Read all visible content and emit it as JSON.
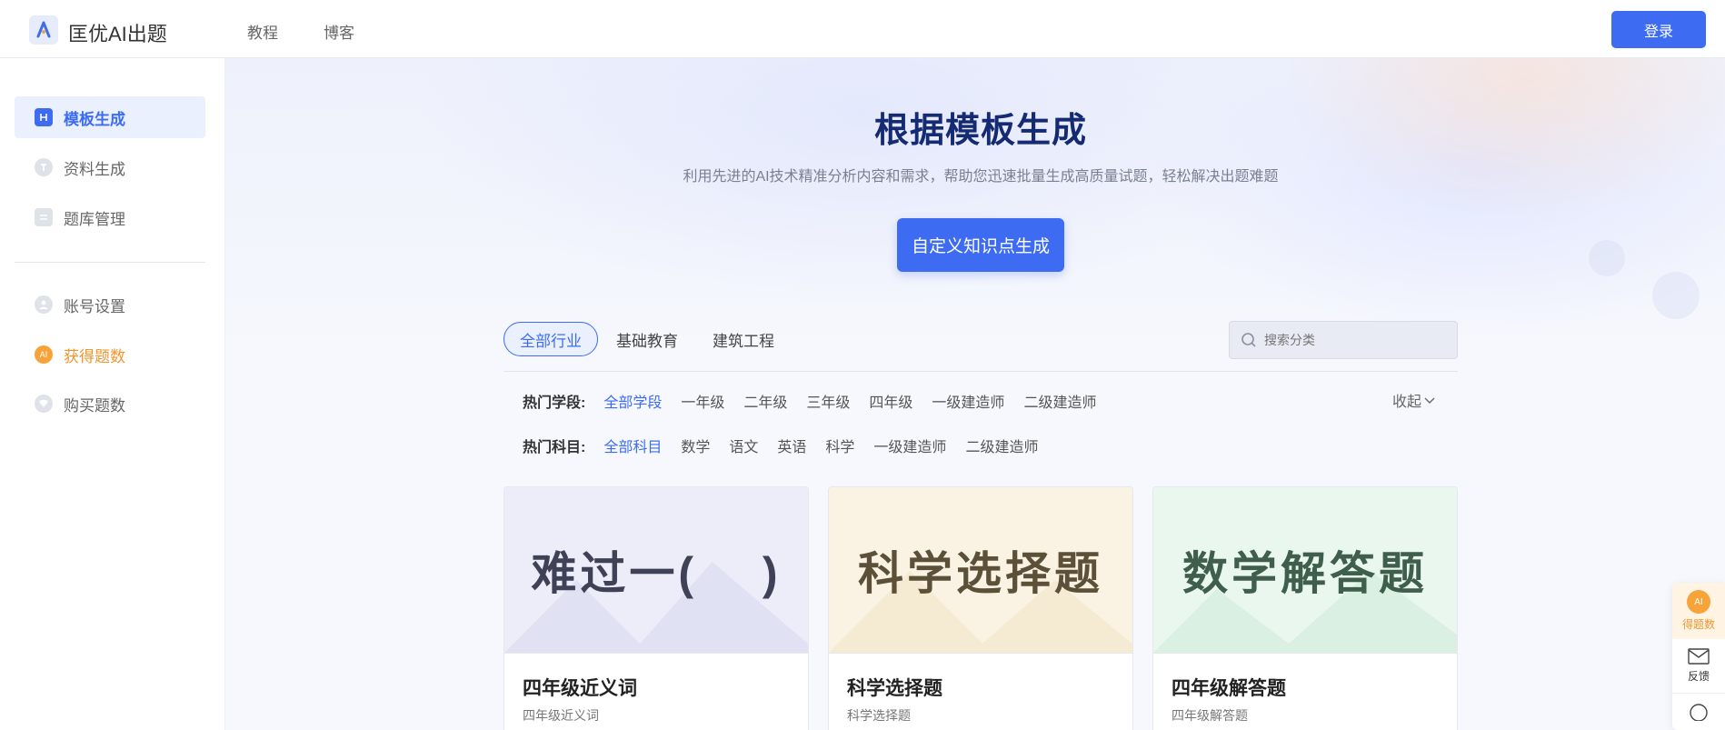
{
  "header": {
    "brand": "匡优AI出题",
    "nav": [
      "教程",
      "博客"
    ],
    "login_label": "登录"
  },
  "sidebar": {
    "items": [
      {
        "label": "模板生成",
        "icon": "template-icon",
        "active": true
      },
      {
        "label": "资料生成",
        "icon": "document-icon"
      },
      {
        "label": "题库管理",
        "icon": "question-bank-icon"
      },
      {
        "label": "账号设置",
        "icon": "user-icon"
      },
      {
        "label": "获得题数",
        "icon": "ai-coin-icon",
        "ai_text": "AI"
      },
      {
        "label": "购买题数",
        "icon": "diamond-icon"
      }
    ]
  },
  "hero": {
    "title": "根据模板生成",
    "subtitle": "利用先进的AI技术精准分析内容和需求，帮助您迅速批量生成高质量试题，轻松解决出题难题",
    "button_label": "自定义知识点生成"
  },
  "tabs": [
    "全部行业",
    "基础教育",
    "建筑工程"
  ],
  "search": {
    "placeholder": "搜索分类"
  },
  "filters": {
    "stage_label": "热门学段:",
    "stage_options": [
      "全部学段",
      "一年级",
      "二年级",
      "三年级",
      "四年级",
      "一级建造师",
      "二级建造师"
    ],
    "subject_label": "热门科目:",
    "subject_options": [
      "全部科目",
      "数学",
      "语文",
      "英语",
      "科学",
      "一级建造师",
      "二级建造师"
    ],
    "collapse_label": "收起"
  },
  "cards": [
    {
      "image_text": "难过一(　 )",
      "title": "四年级近义词",
      "subtitle": "四年级近义词",
      "bg": "#ecedf8",
      "color": "#3f4257"
    },
    {
      "image_text": "科学选择题",
      "title": "科学选择题",
      "subtitle": "科学选择题",
      "bg": "#faf3e4",
      "color": "#5c5138"
    },
    {
      "image_text": "数学解答题",
      "title": "四年级解答题",
      "subtitle": "四年级解答题",
      "bg": "#eaf7ef",
      "color": "#3f5e4b"
    }
  ],
  "float_widget": {
    "ai_text": "AI",
    "item1_label": "得题数",
    "item2_label": "反馈"
  },
  "colors": {
    "accent": "#3d6cf2",
    "orange": "#f0962e",
    "title": "#142a72"
  }
}
